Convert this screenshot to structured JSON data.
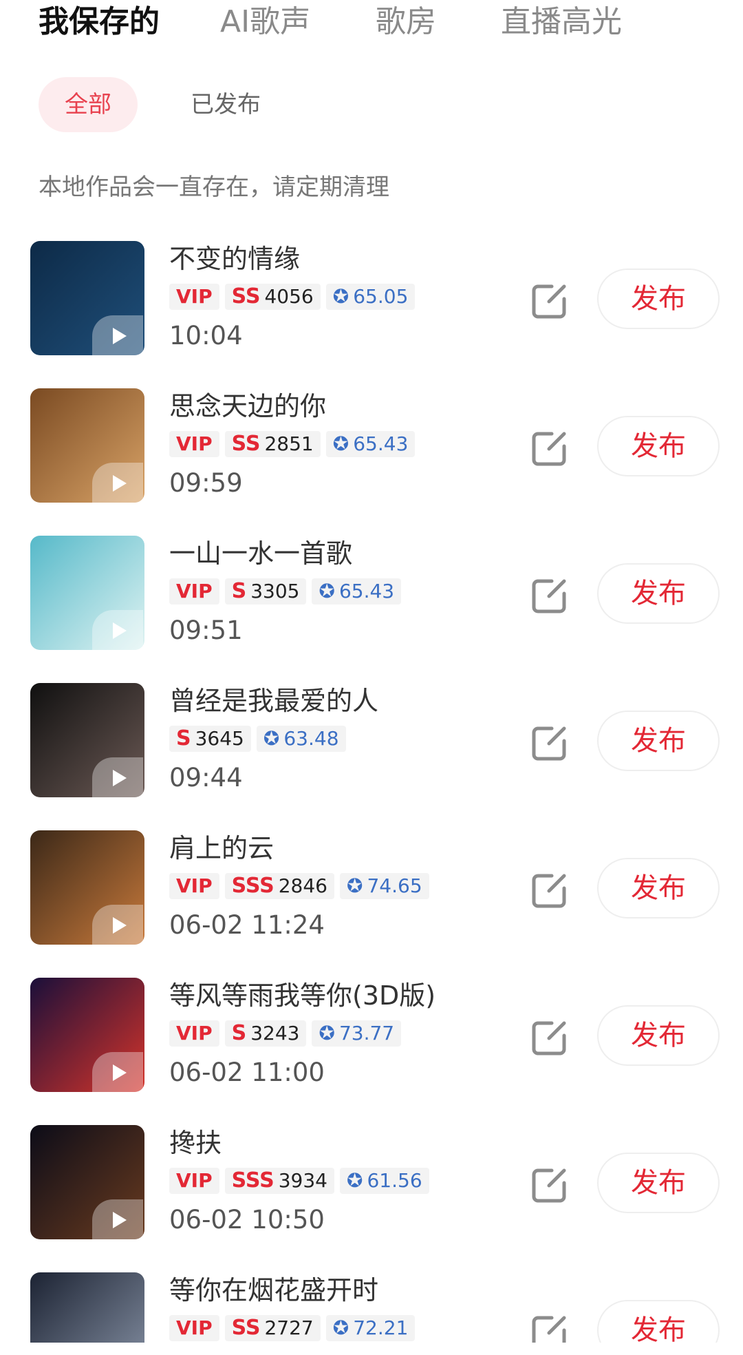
{
  "tabs": [
    {
      "label": "我保存的",
      "active": true
    },
    {
      "label": "AI歌声",
      "active": false
    },
    {
      "label": "歌房",
      "active": false
    },
    {
      "label": "直播高光",
      "active": false
    }
  ],
  "filters": {
    "all": "全部",
    "published": "已发布"
  },
  "notice": "本地作品会一直存在，请定期清理",
  "colors": {
    "accent": "#e32835",
    "score_blue": "#3b6fc4",
    "pill_bg": "#fdecee"
  },
  "songs": [
    {
      "title": "不变的情缘",
      "vip": "VIP",
      "grade": "SS",
      "count": "4056",
      "score": "65.05",
      "time": "10:04",
      "publish": "发布",
      "cover_colors": [
        "#0d2a47",
        "#1f4f7a"
      ]
    },
    {
      "title": "思念天边的你",
      "vip": "VIP",
      "grade": "SS",
      "count": "2851",
      "score": "65.43",
      "time": "09:59",
      "publish": "发布",
      "cover_colors": [
        "#7a4a22",
        "#d9a367"
      ]
    },
    {
      "title": "一山一水一首歌",
      "vip": "VIP",
      "grade": "S",
      "count": "3305",
      "score": "65.43",
      "time": "09:51",
      "publish": "发布",
      "cover_colors": [
        "#56b9c9",
        "#dff3f2"
      ]
    },
    {
      "title": "曾经是我最爱的人",
      "vip": "",
      "grade": "S",
      "count": "3645",
      "score": "63.48",
      "time": "09:44",
      "publish": "发布",
      "cover_colors": [
        "#101010",
        "#6c5a55"
      ]
    },
    {
      "title": "肩上的云",
      "vip": "VIP",
      "grade": "SSS",
      "count": "2846",
      "score": "74.65",
      "time": "06-02 11:24",
      "publish": "发布",
      "cover_colors": [
        "#3b2818",
        "#c97a3b"
      ]
    },
    {
      "title": "等风等雨我等你(3D版)",
      "vip": "VIP",
      "grade": "S",
      "count": "3243",
      "score": "73.77",
      "time": "06-02 11:00",
      "publish": "发布",
      "cover_colors": [
        "#1a0f3a",
        "#d6342a"
      ]
    },
    {
      "title": "搀扶",
      "vip": "VIP",
      "grade": "SSS",
      "count": "3934",
      "score": "61.56",
      "time": "06-02 10:50",
      "publish": "发布",
      "cover_colors": [
        "#0c0c18",
        "#6a3b1f"
      ]
    },
    {
      "title": "等你在烟花盛开时",
      "vip": "VIP",
      "grade": "SS",
      "count": "2727",
      "score": "72.21",
      "time": "",
      "publish": "发布",
      "cover_colors": [
        "#1c2333",
        "#8a95a8"
      ]
    }
  ]
}
